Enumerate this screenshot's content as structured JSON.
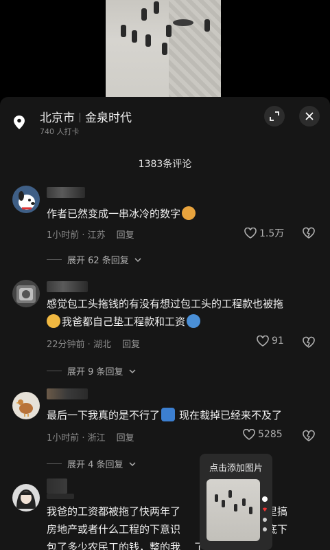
{
  "location": {
    "city": "北京市",
    "place": "金泉时代",
    "checkins": "740 人打卡"
  },
  "comments_count": "1383条评论",
  "comments": [
    {
      "text": "作者已然变成一串冰冷的数字",
      "time_region": "1小时前 · 江苏",
      "reply_label": "回复",
      "likes": "1.5万",
      "expand": "展开 62 条回复"
    },
    {
      "text_line1": "感觉包工头拖钱的有没有想过包工头的工程款也被拖",
      "text_line2": "我爸都自己垫工程款和工资",
      "time_region": "22分钟前 · 湖北",
      "reply_label": "回复",
      "likes": "91",
      "expand": "展开 9 条回复"
    },
    {
      "text_a": "最后一下我真的是不行了",
      "text_b": "现在裁掉已经来不及了",
      "time_region": "1小时前 · 浙江",
      "reply_label": "回复",
      "likes": "5285",
      "expand": "展开 4 条回复"
    },
    {
      "line1_a": "我爸的工资都被拖了快两年了",
      "line1_b": "到家里搞",
      "line2_a": "房地产或者什么工程的下意识",
      "line2_b": "道手底下",
      "line3_a": "包了多少农民工的钱，整的我",
      "line3_b": "了"
    }
  ],
  "popover": {
    "label": "点击添加图片"
  },
  "colors": {
    "sheet_bg": "#161616",
    "text_primary": "#f0f0f0",
    "text_secondary": "#8a8a8a",
    "button_bg": "#2c2c2c"
  },
  "icons": [
    "location-pin-icon",
    "expand-icon",
    "close-icon",
    "heart-icon",
    "dislike-icon",
    "chevron-down-icon"
  ]
}
